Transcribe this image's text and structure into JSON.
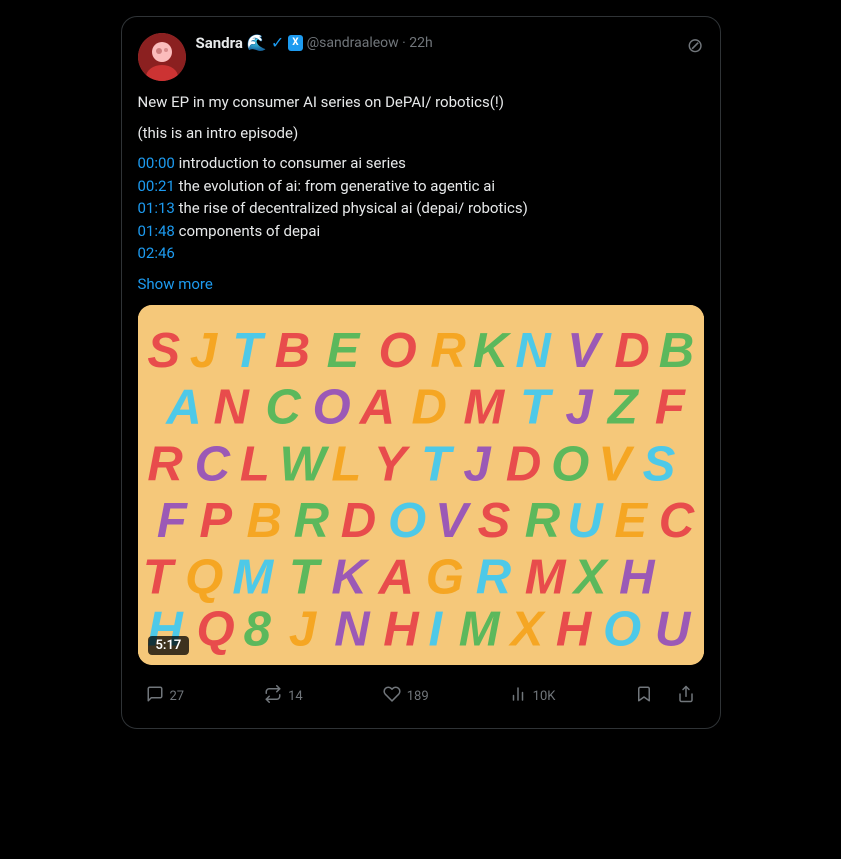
{
  "tweet": {
    "display_name": "Sandra",
    "username": "@sandraaleow",
    "time": "22h",
    "text_line1": "New EP in my consumer AI series on DePAI/ robotics(!)",
    "text_line2": "(this is an intro episode)",
    "timestamps": [
      {
        "time": "00:00",
        "desc": "introduction to consumer ai series"
      },
      {
        "time": "00:21",
        "desc": "the evolution of ai: from generative to agentic ai"
      },
      {
        "time": "01:13",
        "desc": "the rise of decentralized physical ai (depai/ robotics)"
      },
      {
        "time": "01:48",
        "desc": "components of depai"
      },
      {
        "time": "02:46",
        "desc": ""
      }
    ],
    "show_more": "Show more",
    "duration": "5:17",
    "actions": {
      "reply": "27",
      "retweet": "14",
      "like": "189",
      "analytics": "10K"
    },
    "more_options_icon": "⊘"
  }
}
